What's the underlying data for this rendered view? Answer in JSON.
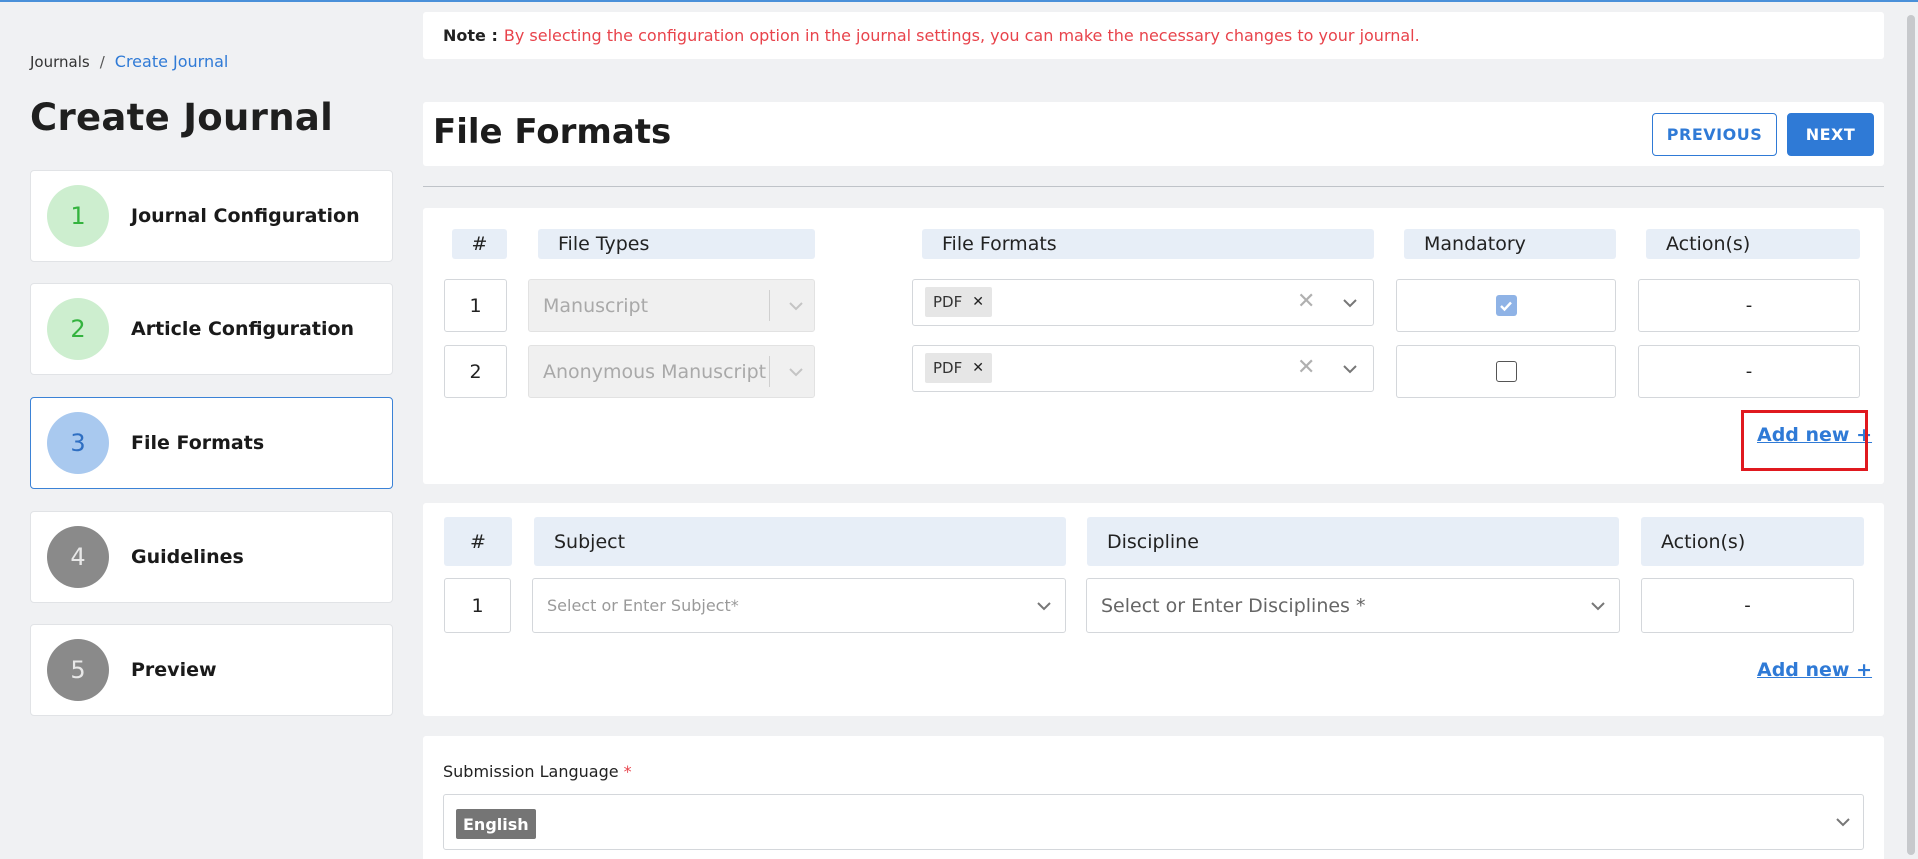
{
  "breadcrumb": {
    "root": "Journals",
    "separator": "/",
    "current": "Create Journal"
  },
  "page_title": "Create Journal",
  "steps": [
    {
      "number": "1",
      "label": "Journal Configuration",
      "state": "done"
    },
    {
      "number": "2",
      "label": "Article Configuration",
      "state": "done"
    },
    {
      "number": "3",
      "label": "File Formats",
      "state": "current"
    },
    {
      "number": "4",
      "label": "Guidelines",
      "state": "todo"
    },
    {
      "number": "5",
      "label": "Preview",
      "state": "todo"
    }
  ],
  "note": {
    "label": "Note :",
    "text": "By selecting the configuration option in the journal settings, you can make the necessary changes to your journal."
  },
  "section": {
    "title": "File Formats",
    "previous_label": "PREVIOUS",
    "next_label": "NEXT"
  },
  "file_table": {
    "headers": {
      "num": "#",
      "file_types": "File Types",
      "file_formats": "File Formats",
      "mandatory": "Mandatory",
      "actions": "Action(s)"
    },
    "rows": [
      {
        "num": "1",
        "file_type": "Manuscript",
        "format_tag": "PDF",
        "mandatory": true,
        "action": "-"
      },
      {
        "num": "2",
        "file_type": "Anonymous Manuscript",
        "format_tag": "PDF",
        "mandatory": false,
        "action": "-"
      }
    ],
    "add_new": "Add new +"
  },
  "subject_table": {
    "headers": {
      "num": "#",
      "subject": "Subject",
      "discipline": "Discipline",
      "actions": "Action(s)"
    },
    "rows": [
      {
        "num": "1",
        "subject_placeholder": "Select or Enter Subject*",
        "discipline_placeholder": "Select or Enter Disciplines *",
        "action": "-"
      }
    ],
    "add_new": "Add new +"
  },
  "submission_language": {
    "label": "Submission Language",
    "required_mark": "*",
    "selected": "English"
  },
  "colors": {
    "accent": "#2f7ad6",
    "note_text": "#e8434b",
    "header_cell": "#e7eef7",
    "highlight": "#e0191f"
  }
}
